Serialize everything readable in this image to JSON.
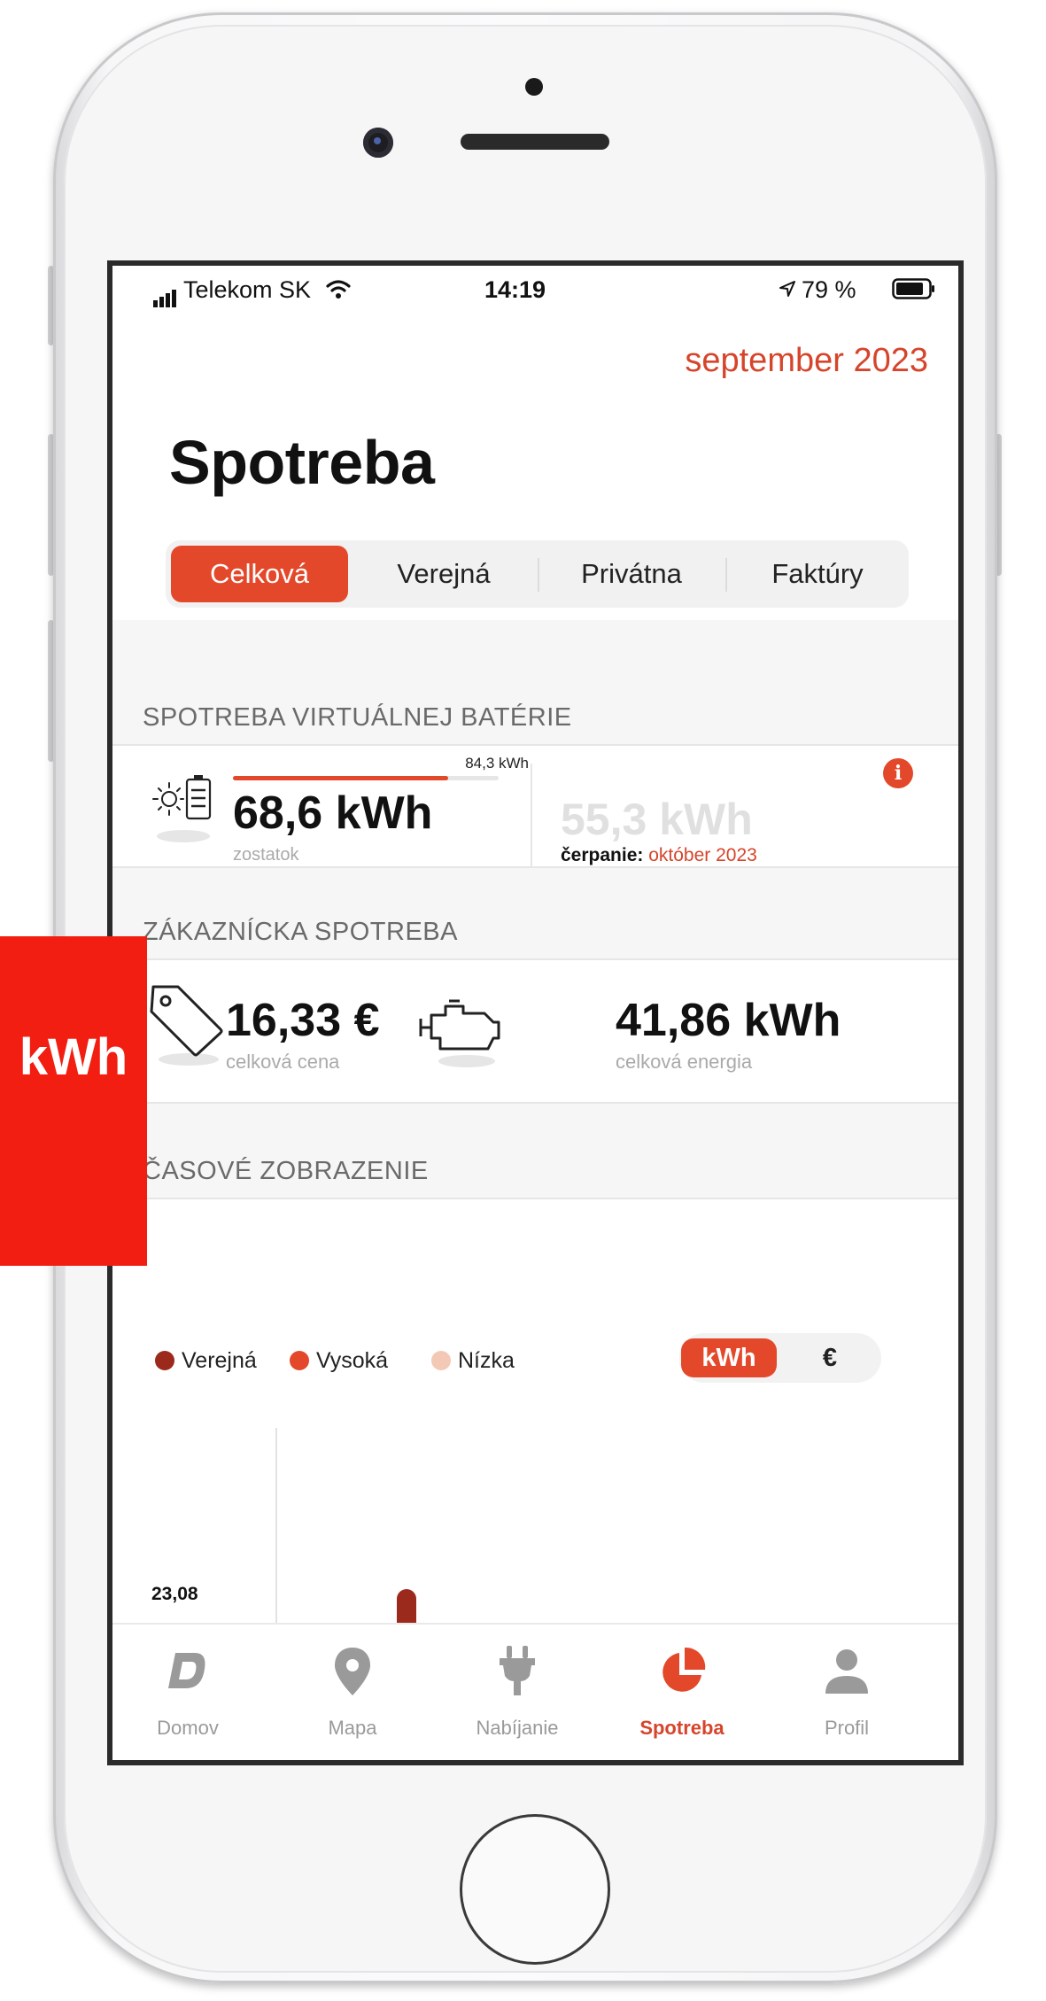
{
  "status_bar": {
    "carrier": "Telekom SK",
    "time": "14:19",
    "battery": "79 %"
  },
  "header": {
    "month": "september 2023",
    "title": "Spotreba"
  },
  "tabs": [
    {
      "label": "Celková",
      "active": true
    },
    {
      "label": "Verejná",
      "active": false
    },
    {
      "label": "Privátna",
      "active": false
    },
    {
      "label": "Faktúry",
      "active": false
    }
  ],
  "battery_section": {
    "heading": "SPOTREBA VIRTUÁLNEJ BATÉRIE",
    "capacity": "84,3 kWh",
    "remaining_fraction": 0.81,
    "remaining_value": "68,6 kWh",
    "remaining_label": "zostatok",
    "draw_value": "55,3 kWh",
    "draw_label": "čerpanie:",
    "draw_month": "október 2023"
  },
  "customer_section": {
    "heading": "ZÁKAZNÍCKA SPOTREBA",
    "price_value": "16,33 €",
    "price_label": "celková cena",
    "energy_value": "41,86 kWh",
    "energy_label": "celková energia"
  },
  "time_section": {
    "heading": "ČASOVÉ ZOBRAZENIE",
    "legend": [
      {
        "label": "Verejná",
        "color": "#9b2a1c"
      },
      {
        "label": "Vysoká",
        "color": "#e4482a"
      },
      {
        "label": "Nízka",
        "color": "#f3c9b6"
      }
    ],
    "unit_toggle": {
      "on": "kWh",
      "off": "€"
    },
    "y_tick": "23,08"
  },
  "tabbar": [
    {
      "label": "Domov",
      "icon": "logo-d-icon",
      "active": false
    },
    {
      "label": "Mapa",
      "icon": "map-pin-icon",
      "active": false
    },
    {
      "label": "Nabíjanie",
      "icon": "plug-icon",
      "active": false
    },
    {
      "label": "Spotreba",
      "icon": "pie-chart-icon",
      "active": true
    },
    {
      "label": "Profil",
      "icon": "person-icon",
      "active": false
    }
  ],
  "overlay": {
    "label": "kWh"
  },
  "colors": {
    "accent": "#e4482a",
    "accent_text": "#d6452b",
    "overlay": "#f21e12"
  }
}
